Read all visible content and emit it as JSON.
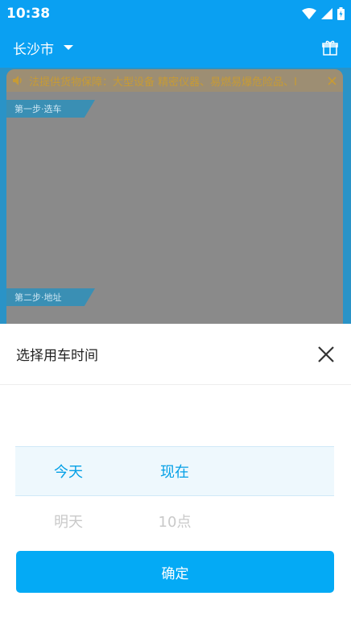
{
  "status_bar": {
    "time": "10:38"
  },
  "app_bar": {
    "city": "长沙市"
  },
  "notice": {
    "text": "法提供货物保障：大型设备 精密仪器、易燃易爆危险品、I"
  },
  "steps": {
    "step1": "第一步·选车",
    "step2": "第二步·地址"
  },
  "sheet": {
    "title": "选择用车时间",
    "picker": {
      "day_selected": "今天",
      "day_next": "明天",
      "time_selected": "现在",
      "time_next": "10点"
    },
    "confirm_label": "确定"
  },
  "colors": {
    "accent": "#04aaf5",
    "selected_text": "#04a0e6",
    "muted_text": "#c9c9c9"
  }
}
